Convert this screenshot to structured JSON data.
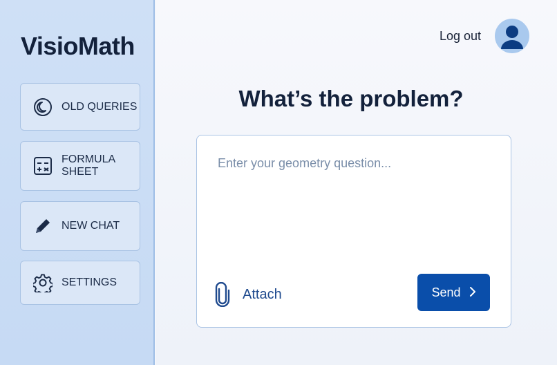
{
  "app": {
    "name": "VisioMath"
  },
  "colors": {
    "accent": "#0a4eaa",
    "sidebar_bg": "#cfe0f6",
    "text": "#13213b"
  },
  "sidebar": {
    "items": [
      {
        "label": "OLD QUERIES",
        "icon": "history-moon-icon"
      },
      {
        "label": "FORMULA\nSHEET",
        "icon": "calculator-icon"
      },
      {
        "label": "NEW CHAT",
        "icon": "pencil-icon"
      },
      {
        "label": "SETTINGS",
        "icon": "gear-icon"
      }
    ]
  },
  "header": {
    "logout_label": "Log out",
    "avatar_icon": "user-avatar-icon"
  },
  "main": {
    "heading": "What’s the problem?",
    "input_placeholder": "Enter your geometry question...",
    "input_value": "",
    "attach_label": "Attach",
    "send_label": "Send"
  }
}
